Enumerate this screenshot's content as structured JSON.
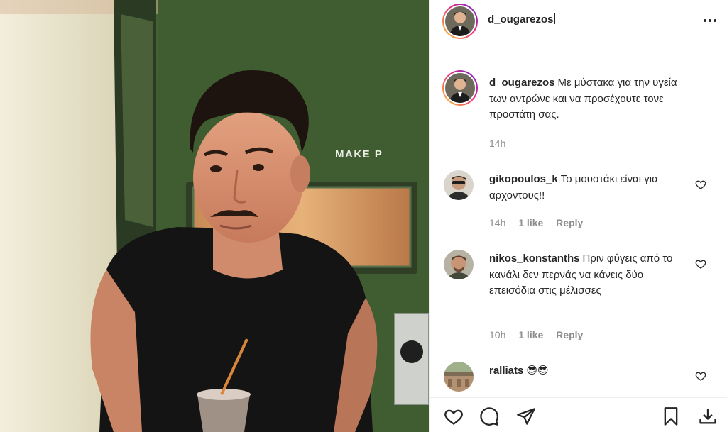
{
  "post": {
    "username": "d_ougarezos",
    "more_icon": "more-horizontal-icon"
  },
  "photo": {
    "door_text": "MAKE    P"
  },
  "caption": {
    "username": "d_ougarezos",
    "text": "Με μύστακα για την υγεία των αντρώνε και να προσέχουτε τονε προστάτη σας.",
    "time": "14h"
  },
  "comments": [
    {
      "username": "gikopoulos_k",
      "text": "Το μουστάκι είναι για αρχοντους!!",
      "time": "14h",
      "likes": "1 like",
      "reply": "Reply"
    },
    {
      "username": "nikos_konstanths",
      "text": "Πριν φύγεις από το κανάλι δεν περνάς να κάνεις δύο επεισόδια στις μέλισσες",
      "time": "10h",
      "likes": "1 like",
      "reply": "Reply"
    },
    {
      "username": "ralliats",
      "text": "😎😎"
    }
  ],
  "actions": {
    "like_icon": "heart-icon",
    "comment_icon": "comment-icon",
    "share_icon": "send-icon",
    "save_icon": "bookmark-icon",
    "download_icon": "download-icon"
  },
  "colors": {
    "text": "#262626",
    "meta": "#8e8e8e",
    "border": "#efefef",
    "wall_green": "#3f5a33"
  }
}
